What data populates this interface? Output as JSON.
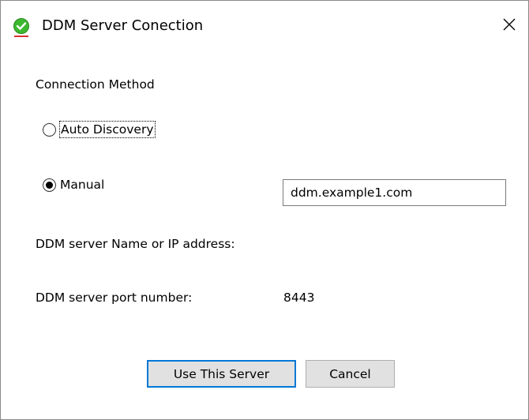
{
  "window": {
    "title": "DDM Server Conection",
    "icon": "green-checkmark-shield-icon",
    "close_icon": "close-icon"
  },
  "form": {
    "connection_method_label": "Connection Method",
    "options": [
      {
        "label": "Auto Discovery",
        "selected": false
      },
      {
        "label": "Manual",
        "selected": true
      }
    ],
    "server_name_label": "DDM server Name or IP address:",
    "server_name_value": "ddm.example1.com",
    "port_label": "DDM server port number:",
    "port_value": "8443"
  },
  "buttons": {
    "use_server": "Use This Server",
    "cancel": "Cancel"
  },
  "colors": {
    "default_button_border": "#0078d7",
    "button_bg": "#e1e1e1",
    "icon_green": "#3cb82e"
  }
}
